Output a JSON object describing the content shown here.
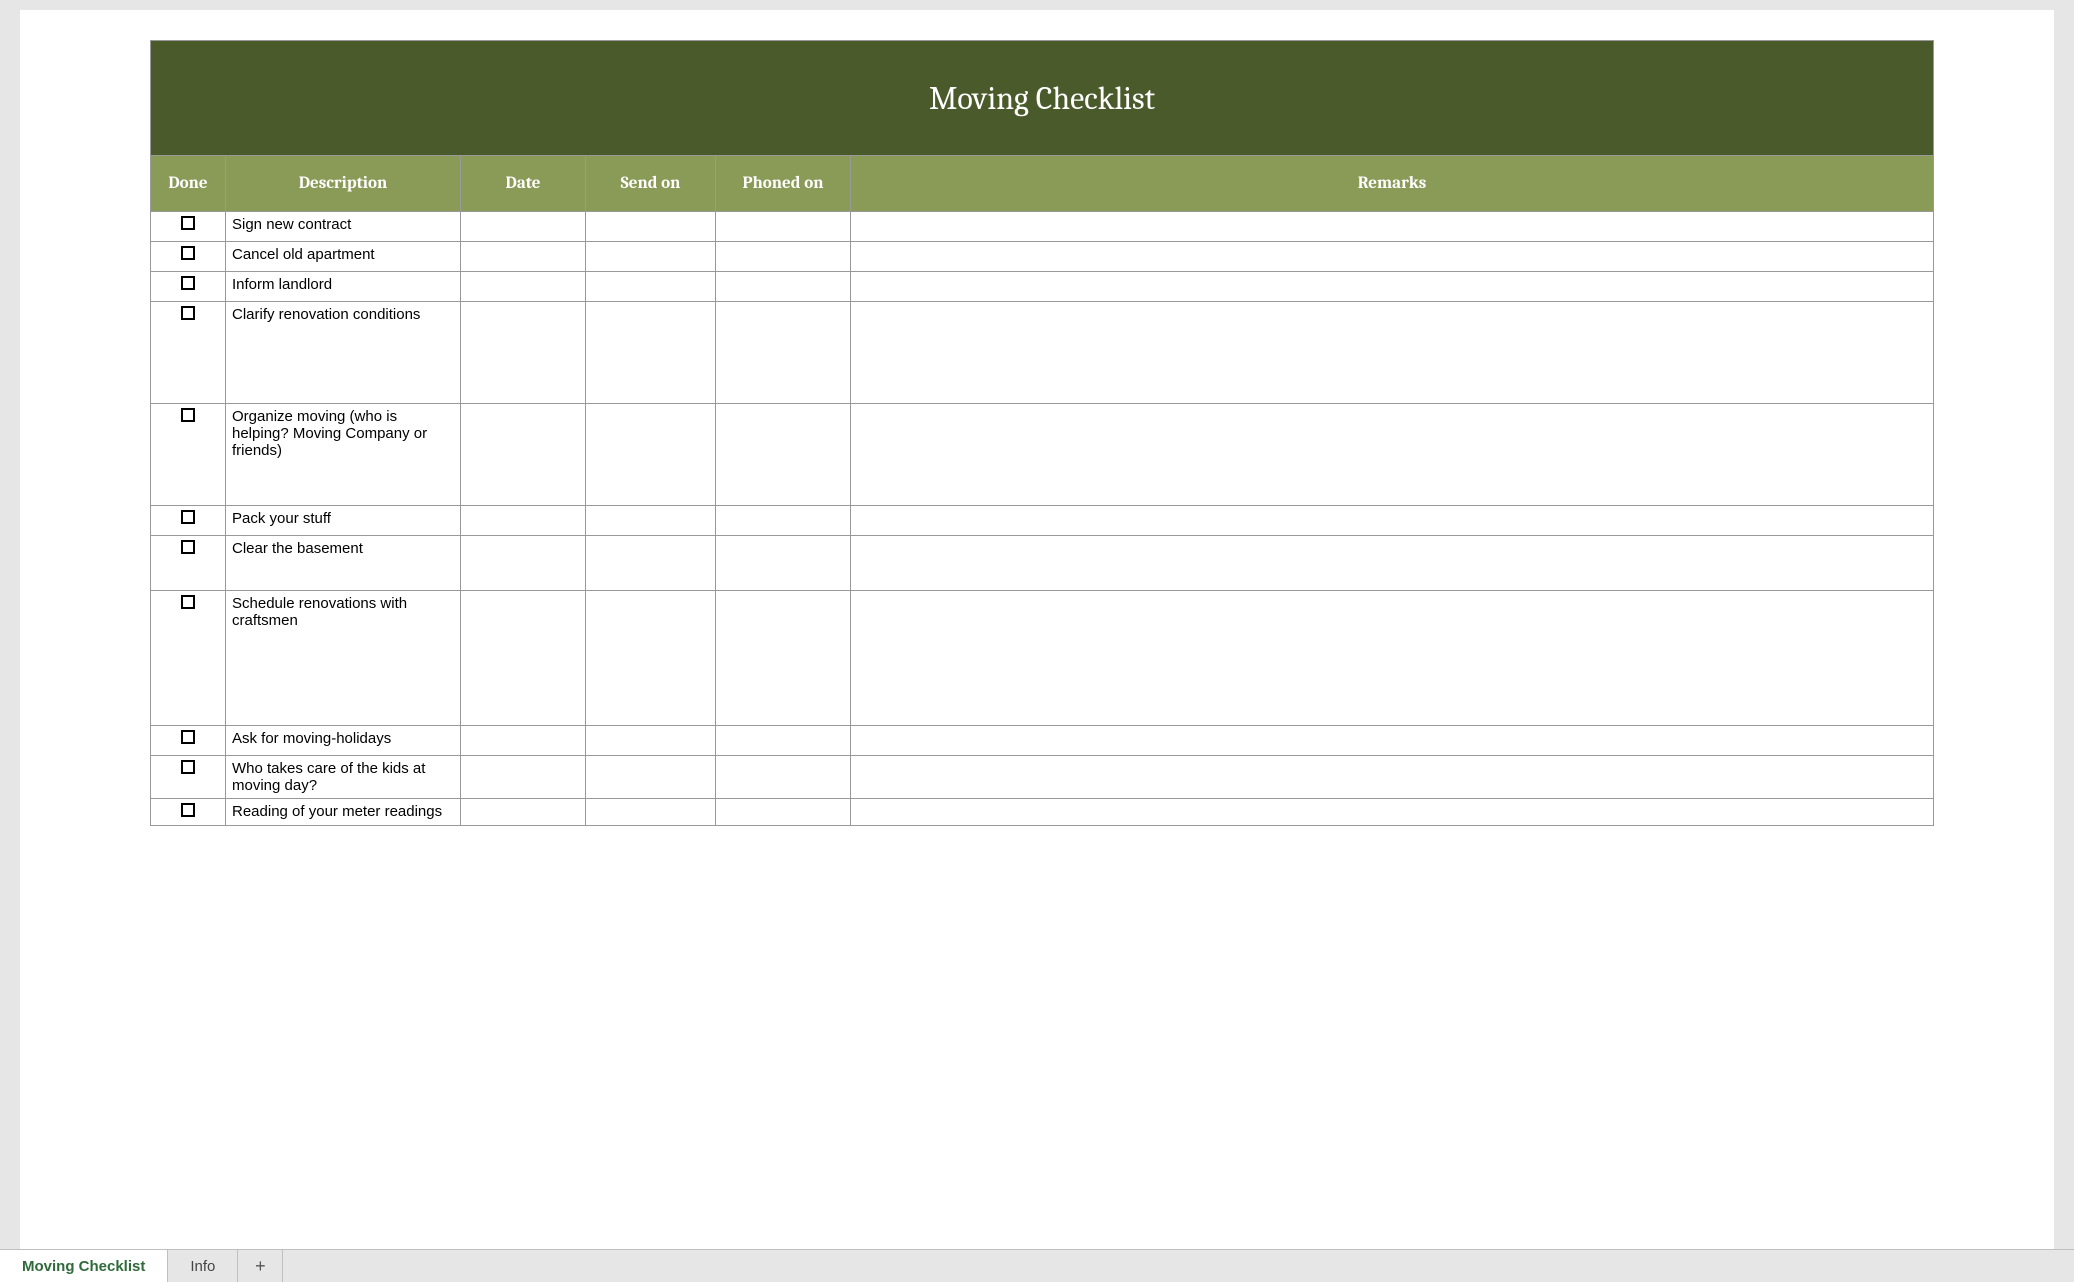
{
  "title": "Moving Checklist",
  "columns": {
    "done": "Done",
    "description": "Description",
    "date": "Date",
    "send_on": "Send on",
    "phoned_on": "Phoned on",
    "remarks": "Remarks"
  },
  "rows": [
    {
      "done": false,
      "description": "Sign new contract",
      "date": "",
      "send_on": "",
      "phoned_on": "",
      "remarks": "",
      "size": "small"
    },
    {
      "done": false,
      "description": "Cancel old apartment",
      "date": "",
      "send_on": "",
      "phoned_on": "",
      "remarks": "",
      "size": "small"
    },
    {
      "done": false,
      "description": "Inform landlord",
      "date": "",
      "send_on": "",
      "phoned_on": "",
      "remarks": "",
      "size": "small"
    },
    {
      "done": false,
      "description": "Clarify renovation conditions",
      "date": "",
      "send_on": "",
      "phoned_on": "",
      "remarks": "",
      "size": "tall"
    },
    {
      "done": false,
      "description": "Organize moving (who is helping? Moving Company or friends)",
      "date": "",
      "send_on": "",
      "phoned_on": "",
      "remarks": "",
      "size": "tall"
    },
    {
      "done": false,
      "description": "Pack your stuff",
      "date": "",
      "send_on": "",
      "phoned_on": "",
      "remarks": "",
      "size": "small"
    },
    {
      "done": false,
      "description": "Clear the basement",
      "date": "",
      "send_on": "",
      "phoned_on": "",
      "remarks": "",
      "size": "med"
    },
    {
      "done": false,
      "description": "Schedule renovations with craftsmen",
      "date": "",
      "send_on": "",
      "phoned_on": "",
      "remarks": "",
      "size": "big"
    },
    {
      "done": false,
      "description": "Ask for moving-holidays",
      "date": "",
      "send_on": "",
      "phoned_on": "",
      "remarks": "",
      "size": "small"
    },
    {
      "done": false,
      "description": "Who takes care of the kids at moving day?",
      "date": "",
      "send_on": "",
      "phoned_on": "",
      "remarks": "",
      "size": "small"
    },
    {
      "done": false,
      "description": "Reading of your meter readings",
      "date": "",
      "send_on": "",
      "phoned_on": "",
      "remarks": "",
      "size": "cut"
    }
  ],
  "tabs": {
    "active": "Moving Checklist",
    "others": [
      "Info"
    ],
    "plus": "+"
  }
}
